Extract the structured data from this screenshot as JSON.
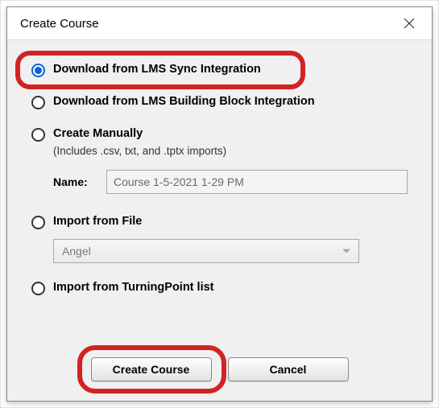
{
  "dialog": {
    "title": "Create Course"
  },
  "options": {
    "sync": {
      "label": "Download from LMS Sync Integration",
      "selected": true
    },
    "bblock": {
      "label": "Download from LMS Building Block Integration",
      "selected": false
    },
    "manual": {
      "label": "Create Manually",
      "sub": "(Includes .csv, txt, and .tptx imports)",
      "name_label": "Name:",
      "name_value": "Course 1-5-2021 1-29 PM",
      "selected": false
    },
    "file": {
      "label": "Import from File",
      "dropdown_value": "Angel",
      "selected": false
    },
    "tplist": {
      "label": "Import from TurningPoint list",
      "selected": false
    }
  },
  "buttons": {
    "create": "Create Course",
    "cancel": "Cancel"
  }
}
